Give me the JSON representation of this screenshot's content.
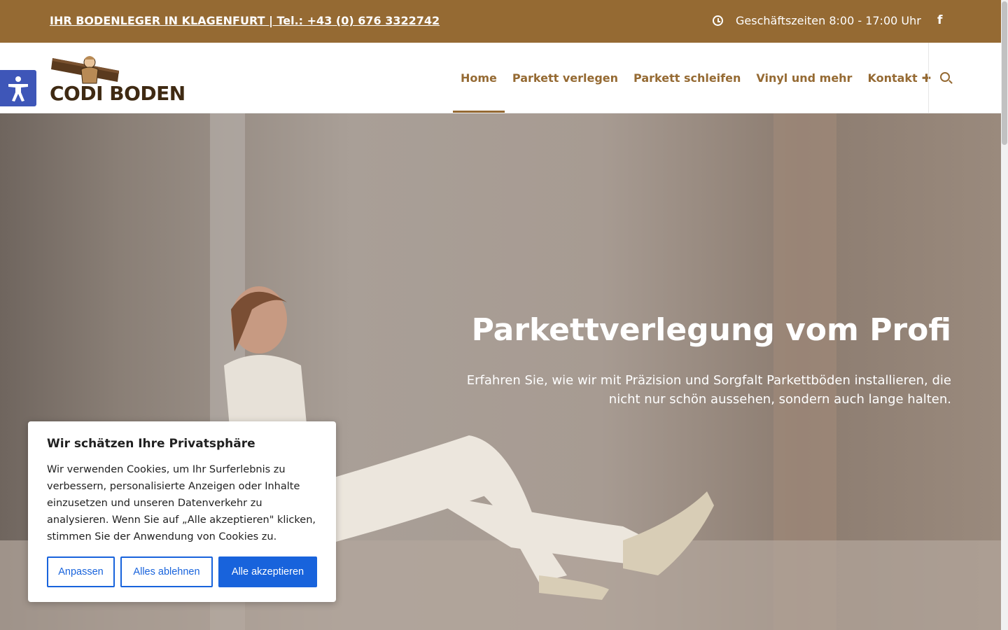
{
  "topbar": {
    "phone_text": "IHR BODENLEGER IN KLAGENFURT | Tel.: +43 (0) 676 3322742",
    "hours_text": "Geschäftszeiten 8:00 - 17:00 Uhr",
    "background": "#956a33"
  },
  "header": {
    "logo_text": "CODI BODEN",
    "nav": {
      "home": "Home",
      "parkett_verlegen": "Parkett verlegen",
      "parkett_schleifen": "Parkett schleifen",
      "vinyl": "Vinyl und mehr",
      "kontakt": "Kontakt",
      "kontakt_plus": "✚"
    },
    "accent": "#956a33"
  },
  "hero": {
    "title": "Parkettverlegung vom Profi",
    "subtitle": "Erfahren Sie, wie wir mit Präzision und Sorgfalt Parkettböden installieren, die nicht nur schön aussehen, sondern auch lange halten."
  },
  "cookie": {
    "title": "Wir schätzen Ihre Privatsphäre",
    "text": "Wir verwenden Cookies, um Ihr Surferlebnis zu verbessern, personalisierte Anzeigen oder Inhalte einzusetzen und unseren Datenverkehr zu analysieren. Wenn Sie auf „Alle akzeptieren\" klicken, stimmen Sie der Anwendung von Cookies zu.",
    "customize_label": "Anpassen",
    "reject_label": "Alles ablehnen",
    "accept_label": "Alle akzeptieren",
    "button_color": "#1863dc"
  },
  "icons": {
    "clock": "clock-icon",
    "facebook": "facebook-icon",
    "search": "search-icon",
    "accessibility": "accessibility-icon"
  }
}
